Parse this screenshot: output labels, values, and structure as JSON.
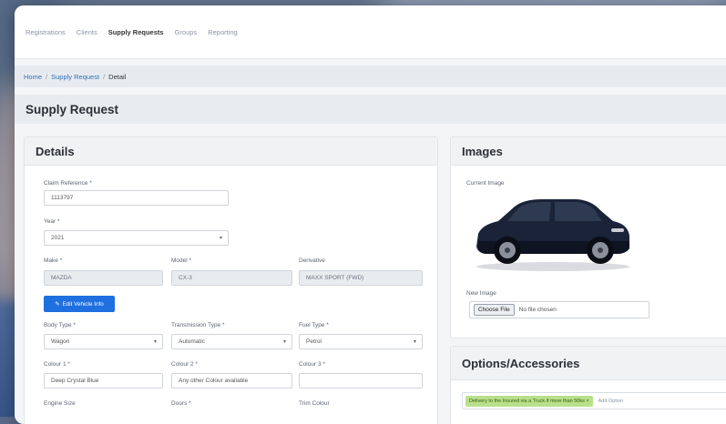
{
  "nav": {
    "items": [
      {
        "label": "Registrations",
        "active": false
      },
      {
        "label": "Clients",
        "active": false
      },
      {
        "label": "Supply Requests",
        "active": true
      },
      {
        "label": "Groups",
        "active": false
      },
      {
        "label": "Reporting",
        "active": false
      }
    ]
  },
  "breadcrumb": {
    "home": "Home",
    "section": "Supply Request",
    "current": "Detail",
    "separator": "/"
  },
  "page": {
    "title": "Supply Request"
  },
  "details": {
    "title": "Details",
    "claim_ref_label": "Claim Reference *",
    "claim_ref_value": "1113797",
    "year_label": "Year *",
    "year_value": "2021",
    "make_label": "Make *",
    "make_value": "MAZDA",
    "model_label": "Model *",
    "model_value": "CX-3",
    "derivative_label": "Derivative",
    "derivative_value": "MAXX SPORT (FWD)",
    "edit_button": "Edit Vehicle Info",
    "body_type_label": "Body Type *",
    "body_type_value": "Wagon",
    "transmission_label": "Transmission Type *",
    "transmission_value": "Automatic",
    "fuel_label": "Fuel Type *",
    "fuel_value": "Petrol",
    "colour1_label": "Colour 1 *",
    "colour1_value": "Deep Crystal Blue",
    "colour2_label": "Colour 2 *",
    "colour2_value": "Any other Colour available",
    "colour3_label": "Colour 3 *",
    "colour3_value": "",
    "engine_label": "Engine Size",
    "doors_label": "Doors *",
    "trim_label": "Trim Colour"
  },
  "images": {
    "title": "Images",
    "current_label": "Current Image",
    "new_label": "New Image",
    "choose_file": "Choose File",
    "no_file": "No file chosen"
  },
  "options": {
    "title": "Options/Accessories",
    "chip": "Delivery to the Insured via a Truck if more than 50ks ×",
    "add_placeholder": "Add Option"
  },
  "colors": {
    "accent": "#1e6fe0",
    "chip_bg": "#b8e08a",
    "car_body": "#1a2338"
  }
}
